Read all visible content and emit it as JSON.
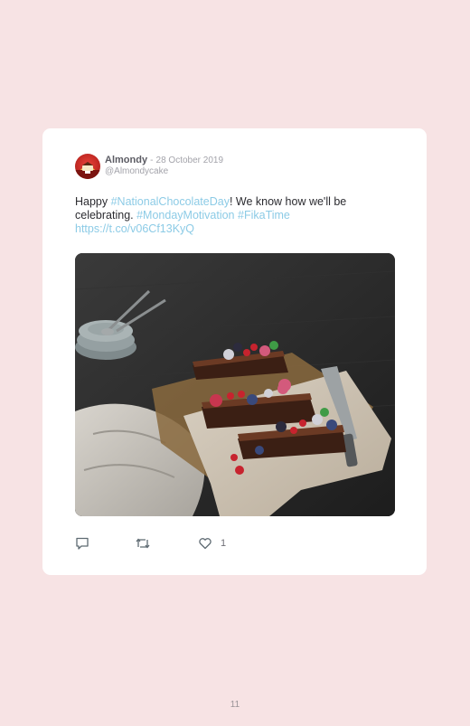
{
  "tweet": {
    "author_name": "Almondy",
    "separator": "-",
    "date": "28 October 2019",
    "handle": "@Almondycake",
    "text_parts": [
      {
        "text": "Happy ",
        "link": false
      },
      {
        "text": "#NationalChocolateDay",
        "link": true
      },
      {
        "text": "! We know how we'll be celebrating. ",
        "link": false
      },
      {
        "text": "#MondayMotivation",
        "link": true
      },
      {
        "text": " ",
        "link": false
      },
      {
        "text": "#FikaTime",
        "link": true
      },
      {
        "text": " ",
        "link": false
      },
      {
        "text": "https://t.co/v06Cf13KyQ",
        "link": true
      }
    ],
    "like_count": "1"
  },
  "icons": {
    "reply": "speech-bubble-icon",
    "retweet": "retweet-icon",
    "like": "heart-icon"
  },
  "colors": {
    "page_background": "#f7e3e4",
    "card_background": "#ffffff",
    "link": "#8ccbe6",
    "text": "#2b2b30",
    "muted": "#a3a3aa"
  },
  "page_number": "11"
}
